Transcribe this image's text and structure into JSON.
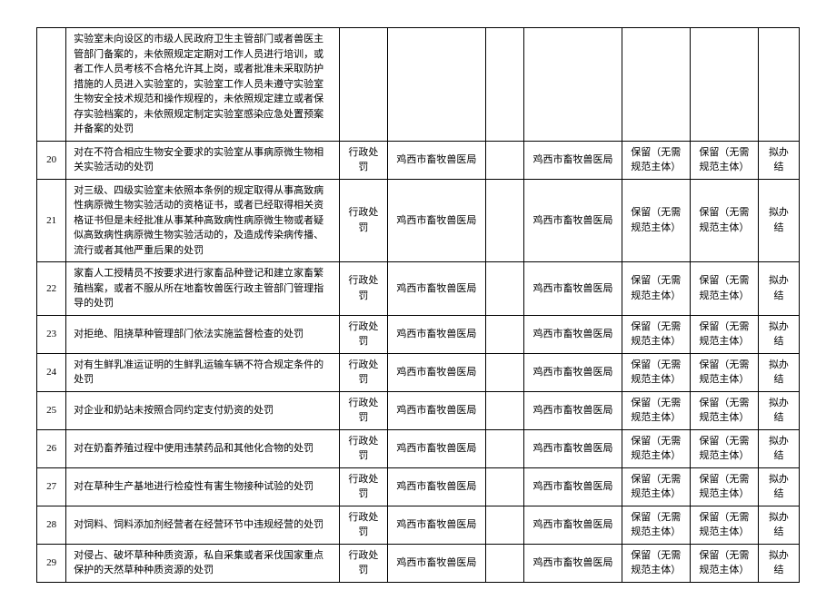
{
  "rows": [
    {
      "idx": "",
      "desc": "实验室未向设区的市级人民政府卫生主管部门或者兽医主管部门备案的，未依照规定定期对工作人员进行培训，或者工作人员考核不合格允许其上岗，或者批准未采取防护措施的人员进入实验室的，实验室工作人员未遵守实验室生物安全技术规范和操作规程的，未依照规定建立或者保存实验档案的，未依照规定制定实验室感染应急处置预案并备案的处罚",
      "type": "",
      "dept1": "",
      "blank": "",
      "dept2": "",
      "keep1": "",
      "keep2": "",
      "result": ""
    },
    {
      "idx": "20",
      "desc": "对在不符合相应生物安全要求的实验室从事病原微生物相关实验活动的处罚",
      "type": "行政处罚",
      "dept1": "鸡西市畜牧兽医局",
      "blank": "",
      "dept2": "鸡西市畜牧兽医局",
      "keep1": "保留（无需规范主体）",
      "keep2": "保留（无需规范主体）",
      "result": "拟办结"
    },
    {
      "idx": "21",
      "desc": "对三级、四级实验室未依照本条例的规定取得从事高致病性病原微生物实验活动的资格证书，或者已经取得相关资格证书但是未经批准从事某种高致病性病原微生物或者疑似高致病性病原微生物实验活动的，及造成传染病传播、流行或者其他严重后果的处罚",
      "type": "行政处罚",
      "dept1": "鸡西市畜牧兽医局",
      "blank": "",
      "dept2": "鸡西市畜牧兽医局",
      "keep1": "保留（无需规范主体）",
      "keep2": "保留（无需规范主体）",
      "result": "拟办结"
    },
    {
      "idx": "22",
      "desc": "家畜人工授精员不按要求进行家畜品种登记和建立家畜繁殖档案，或者不服从所在地畜牧兽医行政主管部门管理指导的处罚",
      "type": "行政处罚",
      "dept1": "鸡西市畜牧兽医局",
      "blank": "",
      "dept2": "鸡西市畜牧兽医局",
      "keep1": "保留（无需规范主体）",
      "keep2": "保留（无需规范主体）",
      "result": "拟办结"
    },
    {
      "idx": "23",
      "desc": "对拒绝、阻挠草种管理部门依法实施监督检查的处罚",
      "type": "行政处罚",
      "dept1": "鸡西市畜牧兽医局",
      "blank": "",
      "dept2": "鸡西市畜牧兽医局",
      "keep1": "保留（无需规范主体）",
      "keep2": "保留（无需规范主体）",
      "result": "拟办结"
    },
    {
      "idx": "24",
      "desc": "对有生鲜乳准运证明的生鲜乳运输车辆不符合规定条件的处罚",
      "type": "行政处罚",
      "dept1": "鸡西市畜牧兽医局",
      "blank": "",
      "dept2": "鸡西市畜牧兽医局",
      "keep1": "保留（无需规范主体）",
      "keep2": "保留（无需规范主体）",
      "result": "拟办结"
    },
    {
      "idx": "25",
      "desc": "对企业和奶站未按照合同约定支付奶资的处罚",
      "type": "行政处罚",
      "dept1": "鸡西市畜牧兽医局",
      "blank": "",
      "dept2": "鸡西市畜牧兽医局",
      "keep1": "保留（无需规范主体）",
      "keep2": "保留（无需规范主体）",
      "result": "拟办结"
    },
    {
      "idx": "26",
      "desc": "对在奶畜养殖过程中使用违禁药品和其他化合物的处罚",
      "type": "行政处罚",
      "dept1": "鸡西市畜牧兽医局",
      "blank": "",
      "dept2": "鸡西市畜牧兽医局",
      "keep1": "保留（无需规范主体）",
      "keep2": "保留（无需规范主体）",
      "result": "拟办结"
    },
    {
      "idx": "27",
      "desc": "对在草种生产基地进行检疫性有害生物接种试验的处罚",
      "type": "行政处罚",
      "dept1": "鸡西市畜牧兽医局",
      "blank": "",
      "dept2": "鸡西市畜牧兽医局",
      "keep1": "保留（无需规范主体）",
      "keep2": "保留（无需规范主体）",
      "result": "拟办结"
    },
    {
      "idx": "28",
      "desc": "对饲料、饲料添加剂经营者在经营环节中违规经营的处罚",
      "type": "行政处罚",
      "dept1": "鸡西市畜牧兽医局",
      "blank": "",
      "dept2": "鸡西市畜牧兽医局",
      "keep1": "保留（无需规范主体）",
      "keep2": "保留（无需规范主体）",
      "result": "拟办结"
    },
    {
      "idx": "29",
      "desc": "对侵占、破坏草种种质资源，私自采集或者采伐国家重点保护的天然草种种质资源的处罚",
      "type": "行政处罚",
      "dept1": "鸡西市畜牧兽医局",
      "blank": "",
      "dept2": "鸡西市畜牧兽医局",
      "keep1": "保留（无需规范主体）",
      "keep2": "保留（无需规范主体）",
      "result": "拟办结"
    }
  ]
}
